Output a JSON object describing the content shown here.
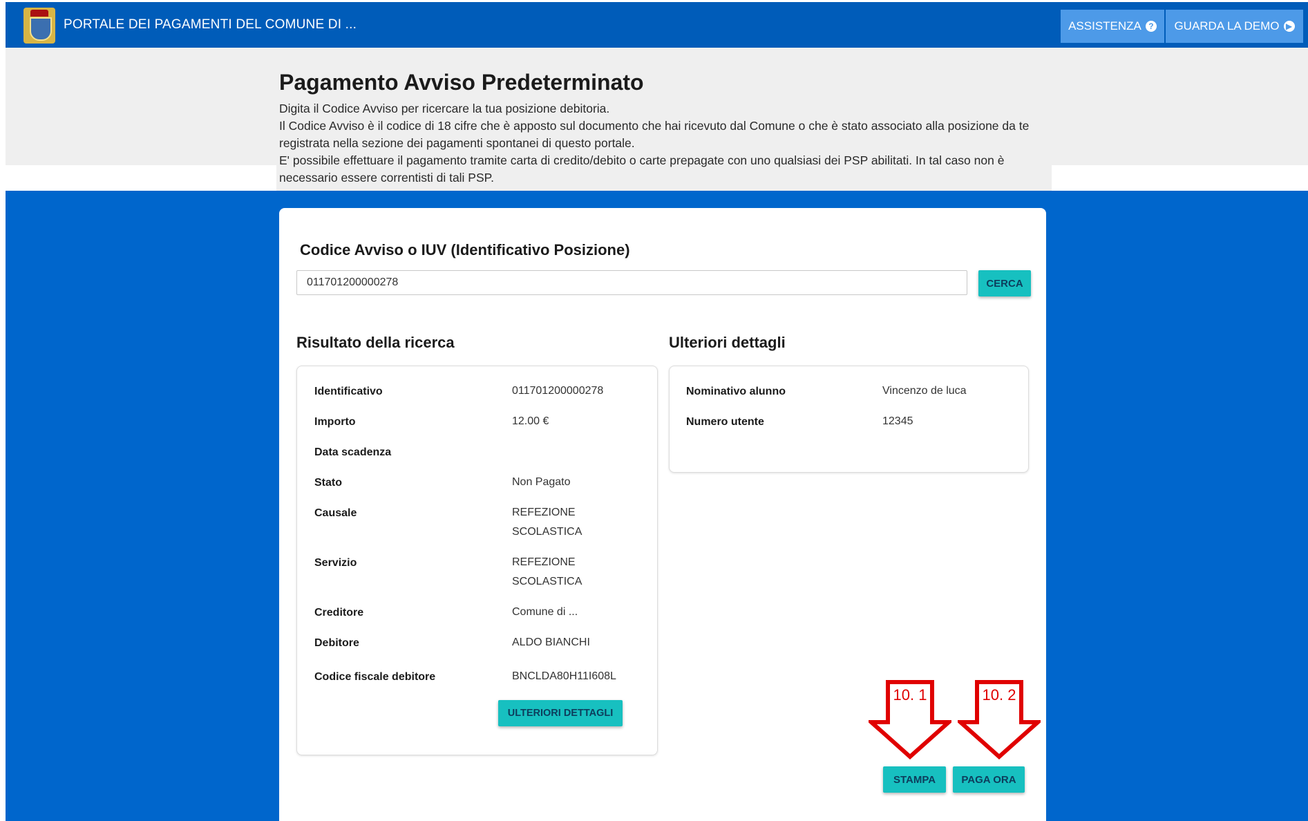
{
  "header": {
    "portal_title": "PORTALE DEI PAGAMENTI DEL COMUNE DI ...",
    "assistenza_label": "ASSISTENZA",
    "demo_label": "GUARDA LA DEMO"
  },
  "intro": {
    "title": "Pagamento Avviso Predeterminato",
    "line1": "Digita il Codice Avviso per ricercare la tua posizione debitoria.",
    "line2": "Il Codice Avviso è il codice di 18 cifre che è apposto sul documento che hai ricevuto dal Comune o che è stato associato alla posizione da te registrata nella sezione dei pagamenti spontanei di questo portale.",
    "line3": "E' possibile effettuare il pagamento tramite carta di credito/debito o carte prepagate con uno qualsiasi dei PSP abilitati. In tal caso non è necessario essere correntisti di tali PSP."
  },
  "search": {
    "label": "Codice Avviso o IUV (Identificativo Posizione)",
    "value": "011701200000278",
    "button": "CERCA"
  },
  "result": {
    "title": "Risultato della ricerca",
    "rows": [
      {
        "key": "Identificativo",
        "value": "011701200000278"
      },
      {
        "key": "Importo",
        "value": "12.00 €"
      },
      {
        "key": "Data scadenza",
        "value": ""
      },
      {
        "key": "Stato",
        "value": "Non Pagato"
      },
      {
        "key": "Causale",
        "value": "REFEZIONE SCOLASTICA"
      },
      {
        "key": "Servizio",
        "value": "REFEZIONE SCOLASTICA"
      },
      {
        "key": "Creditore",
        "value": "Comune di ..."
      },
      {
        "key": "Debitore",
        "value": "ALDO BIANCHI"
      },
      {
        "key": "Codice fiscale debitore",
        "value": "BNCLDA80H11I608L"
      }
    ],
    "details_button": "ULTERIORI DETTAGLI"
  },
  "details": {
    "title": "Ulteriori dettagli",
    "rows": [
      {
        "key": "Nominativo alunno",
        "value": "Vincenzo de luca"
      },
      {
        "key": "Numero utente",
        "value": "12345"
      }
    ]
  },
  "actions": {
    "print_button": "STAMPA",
    "pay_button": "PAGA ORA"
  },
  "annotations": {
    "arrow1": "10. 1",
    "arrow2": "10. 2",
    "color": "#e00000"
  },
  "colors": {
    "topbar": "#005cb9",
    "background": "#0066cc",
    "accent_button": "#17c0c0"
  }
}
